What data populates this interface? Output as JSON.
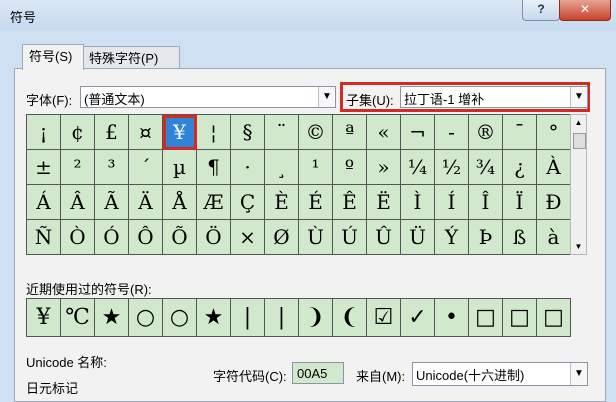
{
  "window": {
    "title": "符号",
    "help_label": "?",
    "close_label": "✕"
  },
  "tabs": [
    {
      "label": "符号(S)"
    },
    {
      "label": "特殊字符(P)"
    }
  ],
  "font": {
    "label": "字体(F):",
    "value": "(普通文本)"
  },
  "subset": {
    "label": "子集(U):",
    "value": "拉丁语-1 增补"
  },
  "symbols": [
    "¡",
    "¢",
    "£",
    "¤",
    "¥",
    "¦",
    "§",
    "¨",
    "©",
    "ª",
    "«",
    "¬",
    "-",
    "®",
    "¯",
    "°",
    "±",
    "²",
    "³",
    "´",
    "µ",
    "¶",
    "·",
    "¸",
    "¹",
    "º",
    "»",
    "¼",
    "½",
    "¾",
    "¿",
    "À",
    "Á",
    "Â",
    "Ã",
    "Ä",
    "Å",
    "Æ",
    "Ç",
    "È",
    "É",
    "Ê",
    "Ë",
    "Ì",
    "Í",
    "Î",
    "Ï",
    "Ð",
    "Ñ",
    "Ò",
    "Ó",
    "Ô",
    "Õ",
    "Ö",
    "×",
    "Ø",
    "Ù",
    "Ú",
    "Û",
    "Ü",
    "Ý",
    "Þ",
    "ß",
    "à"
  ],
  "selected_index": 4,
  "recent": {
    "label": "近期使用过的符号(R):",
    "symbols": [
      "¥",
      "℃",
      "★",
      "○",
      "○",
      "★",
      "|",
      "|",
      "❩",
      "❨",
      "☑",
      "✓",
      "•",
      "□",
      "□",
      "□"
    ]
  },
  "unicode_name": {
    "label": "Unicode 名称:",
    "value": "日元标记"
  },
  "char_code": {
    "label": "字符代码(C):",
    "value": "00A5"
  },
  "from": {
    "label": "来自(M):",
    "value": "Unicode(十六进制)"
  }
}
